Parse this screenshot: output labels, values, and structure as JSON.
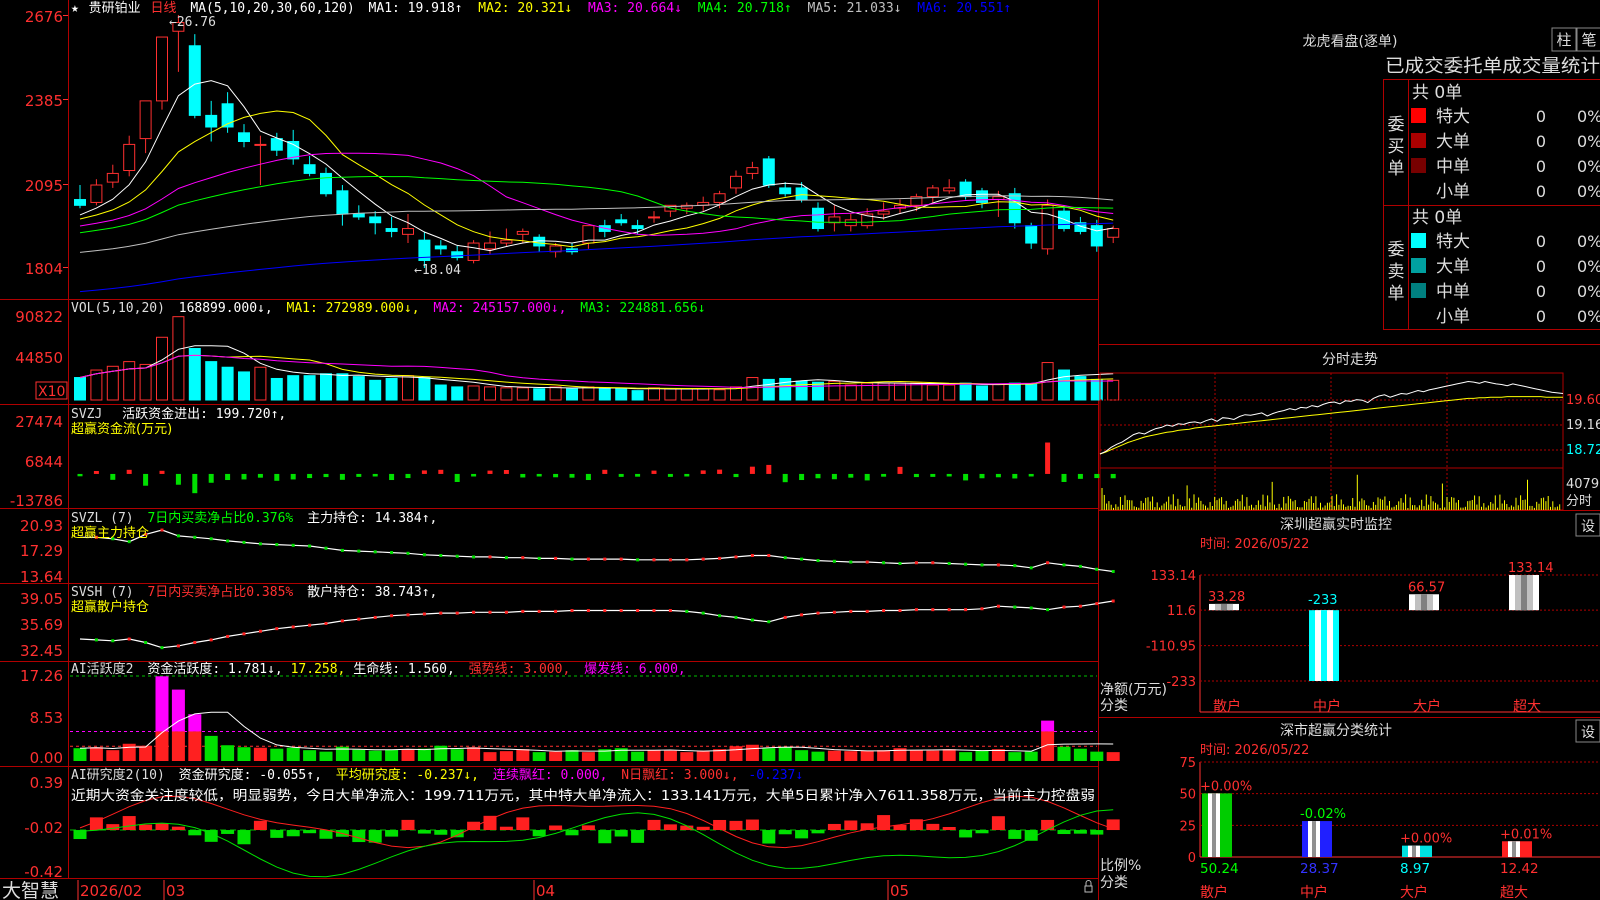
{
  "app": {
    "logo": "大智慧"
  },
  "kline": {
    "star": "★",
    "stock_name": "贵研铂业",
    "period": "日线",
    "ma_title": "MA(5,10,20,30,60,120)",
    "ma_items": [
      {
        "label": "MA1: 19.918↑",
        "color": "#ffffff"
      },
      {
        "label": "MA2: 20.321↓",
        "color": "#ffff00"
      },
      {
        "label": "MA3: 20.664↓",
        "color": "#ff00ff"
      },
      {
        "label": "MA4: 20.718↑",
        "color": "#00ff00"
      },
      {
        "label": "MA5: 21.033↓",
        "color": "#c0c0c0"
      },
      {
        "label": "MA6: 20.551↑",
        "color": "#0000ff"
      }
    ],
    "y_ticks": [
      "2676",
      "2385",
      "2095",
      "1804"
    ],
    "high_label": "←26.76",
    "low_label": "←18.04",
    "colors": {
      "up": "#ff3030",
      "down": "#00ffff",
      "ma1": "#ffffff",
      "ma2": "#ffff00",
      "ma3": "#ff00ff",
      "ma4": "#00ff00",
      "ma5": "#c0c0c0",
      "ma6": "#0000ff"
    },
    "candles": [
      {
        "o": 20.4,
        "h": 20.9,
        "l": 20.1,
        "c": 20.2
      },
      {
        "o": 20.3,
        "h": 21.1,
        "l": 20.2,
        "c": 20.9
      },
      {
        "o": 21.0,
        "h": 21.6,
        "l": 20.8,
        "c": 21.3
      },
      {
        "o": 21.4,
        "h": 22.6,
        "l": 21.2,
        "c": 22.3
      },
      {
        "o": 22.5,
        "h": 23.8,
        "l": 22.0,
        "c": 23.8
      },
      {
        "o": 23.8,
        "h": 26.0,
        "l": 23.5,
        "c": 26.0
      },
      {
        "o": 26.2,
        "h": 26.76,
        "l": 24.8,
        "c": 26.5
      },
      {
        "o": 25.7,
        "h": 26.1,
        "l": 23.2,
        "c": 23.3
      },
      {
        "o": 23.3,
        "h": 23.8,
        "l": 22.4,
        "c": 22.9
      },
      {
        "o": 23.7,
        "h": 24.1,
        "l": 22.7,
        "c": 22.9
      },
      {
        "o": 22.7,
        "h": 23.0,
        "l": 22.2,
        "c": 22.4
      },
      {
        "o": 22.3,
        "h": 22.6,
        "l": 20.9,
        "c": 22.3
      },
      {
        "o": 22.5,
        "h": 22.7,
        "l": 21.9,
        "c": 22.1
      },
      {
        "o": 22.4,
        "h": 22.8,
        "l": 21.6,
        "c": 21.8
      },
      {
        "o": 21.6,
        "h": 21.9,
        "l": 21.2,
        "c": 21.3
      },
      {
        "o": 21.3,
        "h": 21.5,
        "l": 20.5,
        "c": 20.6
      },
      {
        "o": 20.7,
        "h": 20.9,
        "l": 19.5,
        "c": 19.9
      },
      {
        "o": 19.9,
        "h": 20.2,
        "l": 19.7,
        "c": 19.8
      },
      {
        "o": 19.8,
        "h": 20.0,
        "l": 19.2,
        "c": 19.6
      },
      {
        "o": 19.4,
        "h": 19.8,
        "l": 19.1,
        "c": 19.3
      },
      {
        "o": 19.2,
        "h": 19.9,
        "l": 18.9,
        "c": 19.4
      },
      {
        "o": 19.0,
        "h": 19.3,
        "l": 18.04,
        "c": 18.3
      },
      {
        "o": 18.8,
        "h": 19.0,
        "l": 18.5,
        "c": 18.7
      },
      {
        "o": 18.6,
        "h": 18.8,
        "l": 18.3,
        "c": 18.4
      },
      {
        "o": 18.3,
        "h": 19.0,
        "l": 18.2,
        "c": 18.9
      },
      {
        "o": 18.7,
        "h": 19.3,
        "l": 18.5,
        "c": 18.9
      },
      {
        "o": 18.9,
        "h": 19.4,
        "l": 18.8,
        "c": 19.0
      },
      {
        "o": 19.2,
        "h": 19.4,
        "l": 18.9,
        "c": 19.3
      },
      {
        "o": 19.1,
        "h": 19.2,
        "l": 18.6,
        "c": 18.8
      },
      {
        "o": 18.6,
        "h": 18.9,
        "l": 18.4,
        "c": 18.8
      },
      {
        "o": 18.7,
        "h": 18.9,
        "l": 18.5,
        "c": 18.6
      },
      {
        "o": 18.9,
        "h": 19.5,
        "l": 18.7,
        "c": 19.5
      },
      {
        "o": 19.5,
        "h": 19.7,
        "l": 19.1,
        "c": 19.3
      },
      {
        "o": 19.7,
        "h": 19.9,
        "l": 19.5,
        "c": 19.6
      },
      {
        "o": 19.5,
        "h": 19.7,
        "l": 19.2,
        "c": 19.4
      },
      {
        "o": 19.8,
        "h": 20.0,
        "l": 19.6,
        "c": 19.8
      },
      {
        "o": 20.0,
        "h": 20.2,
        "l": 19.8,
        "c": 20.2
      },
      {
        "o": 20.1,
        "h": 20.3,
        "l": 19.9,
        "c": 20.2
      },
      {
        "o": 20.2,
        "h": 20.5,
        "l": 20.0,
        "c": 20.3
      },
      {
        "o": 20.3,
        "h": 20.7,
        "l": 20.1,
        "c": 20.6
      },
      {
        "o": 20.8,
        "h": 21.4,
        "l": 20.6,
        "c": 21.2
      },
      {
        "o": 21.3,
        "h": 21.7,
        "l": 21.1,
        "c": 21.5
      },
      {
        "o": 21.8,
        "h": 21.9,
        "l": 20.8,
        "c": 20.9
      },
      {
        "o": 20.8,
        "h": 21.0,
        "l": 20.5,
        "c": 20.6
      },
      {
        "o": 20.8,
        "h": 21.0,
        "l": 20.3,
        "c": 20.4
      },
      {
        "o": 20.1,
        "h": 20.3,
        "l": 19.3,
        "c": 19.4
      },
      {
        "o": 19.6,
        "h": 20.2,
        "l": 19.3,
        "c": 19.8
      },
      {
        "o": 19.5,
        "h": 19.9,
        "l": 19.3,
        "c": 19.7
      },
      {
        "o": 19.5,
        "h": 20.1,
        "l": 19.4,
        "c": 19.9
      },
      {
        "o": 19.9,
        "h": 20.3,
        "l": 19.7,
        "c": 20.0
      },
      {
        "o": 20.1,
        "h": 20.4,
        "l": 19.9,
        "c": 20.2
      },
      {
        "o": 20.2,
        "h": 20.6,
        "l": 20.0,
        "c": 20.5
      },
      {
        "o": 20.5,
        "h": 20.9,
        "l": 20.3,
        "c": 20.8
      },
      {
        "o": 20.7,
        "h": 21.1,
        "l": 20.6,
        "c": 20.8
      },
      {
        "o": 21.0,
        "h": 21.1,
        "l": 20.4,
        "c": 20.5
      },
      {
        "o": 20.7,
        "h": 20.8,
        "l": 20.1,
        "c": 20.3
      },
      {
        "o": 20.4,
        "h": 20.7,
        "l": 19.8,
        "c": 20.5
      },
      {
        "o": 20.6,
        "h": 20.8,
        "l": 19.4,
        "c": 19.6
      },
      {
        "o": 19.5,
        "h": 19.6,
        "l": 18.7,
        "c": 18.9
      },
      {
        "o": 18.7,
        "h": 20.4,
        "l": 18.5,
        "c": 20.2
      },
      {
        "o": 20.0,
        "h": 20.2,
        "l": 19.3,
        "c": 19.4
      },
      {
        "o": 19.6,
        "h": 19.8,
        "l": 19.2,
        "c": 19.3
      },
      {
        "o": 19.5,
        "h": 19.7,
        "l": 18.6,
        "c": 18.8
      },
      {
        "o": 19.1,
        "h": 19.5,
        "l": 18.9,
        "c": 19.4
      }
    ]
  },
  "volume": {
    "title": "VOL(5,10,20)",
    "v_label": "168899.000↓,",
    "ma_items": [
      {
        "label": "MA1: 272989.000↓,",
        "color": "#ffffff"
      },
      {
        "label": "MA2: 245157.000↓,",
        "color": "#ffff00"
      },
      {
        "label": "MA3: 224881.656↓",
        "color": "#ff00ff"
      }
    ],
    "y_ticks": [
      "90822",
      "44850"
    ],
    "unit": "X10",
    "values": [
      24,
      32,
      36,
      41,
      38,
      67,
      89,
      55,
      41,
      35,
      30,
      35,
      23,
      26,
      26,
      28,
      28,
      25,
      21,
      23,
      26,
      24,
      16,
      14,
      15,
      14,
      13,
      13,
      12,
      14,
      12,
      14,
      12,
      12,
      10,
      13,
      12,
      12,
      12,
      11,
      14,
      24,
      22,
      23,
      20,
      19,
      20,
      16,
      18,
      18,
      18,
      18,
      16,
      16,
      18,
      15,
      17,
      18,
      17,
      40,
      32,
      25,
      22,
      21
    ]
  },
  "svzj": {
    "title": "SVZJ",
    "label": "活跃资金进出: 199.720↑,",
    "subtitle": "超赢资金流(万元)",
    "y_ticks": [
      "27474",
      "6844",
      "-13786"
    ],
    "values": [
      -1200,
      1500,
      -3000,
      2100,
      -6000,
      1600,
      -5500,
      -9800,
      -4500,
      -3100,
      -2800,
      -1900,
      -3500,
      -2800,
      -2100,
      -1600,
      -3000,
      -1500,
      -1300,
      -3100,
      -2100,
      1800,
      2100,
      -4100,
      -1300,
      1700,
      2000,
      -1800,
      -1300,
      -1700,
      -1900,
      -3100,
      2100,
      -1500,
      -1400,
      1700,
      -1500,
      -1300,
      1800,
      2200,
      -1600,
      3700,
      4600,
      -4200,
      -3100,
      -2200,
      -2700,
      -1900,
      -3300,
      -1400,
      3600,
      -1600,
      -1500,
      -1300,
      -3300,
      -2200,
      -1700,
      -2300,
      -1300,
      16000,
      -4100,
      -2500,
      -2100,
      -2200
    ]
  },
  "svzl": {
    "title": "SVZL (7)",
    "label1": "7日内买卖净占比0.376%",
    "label2": "主力持仓: 14.384↑,",
    "subtitle": "超赢主力持仓",
    "y_ticks": [
      "20.93",
      "17.29",
      "13.64"
    ],
    "values": [
      19.1,
      19.1,
      18.9,
      18.5,
      19.5,
      20.1,
      19.3,
      19.1,
      18.9,
      18.6,
      18.4,
      18.2,
      18.1,
      18.0,
      17.9,
      17.6,
      17.3,
      17.2,
      17.1,
      17.0,
      16.9,
      16.7,
      16.6,
      16.5,
      16.4,
      16.4,
      16.3,
      16.3,
      16.2,
      16.2,
      16.1,
      16.1,
      16.1,
      16.1,
      16.0,
      16.0,
      16.0,
      16.0,
      16.1,
      16.2,
      16.4,
      16.6,
      16.6,
      16.3,
      16.1,
      15.9,
      15.8,
      15.7,
      15.7,
      15.6,
      15.5,
      15.6,
      15.6,
      15.5,
      15.4,
      15.3,
      15.3,
      15.2,
      14.9,
      15.6,
      15.3,
      15.1,
      14.7,
      14.4
    ]
  },
  "svsh": {
    "title": "SVSH (7)",
    "label1": "7日内买卖净占比0.385%",
    "label2": "散户持仓: 38.743↑,",
    "subtitle": "超赢散户持仓",
    "y_ticks": [
      "39.05",
      "35.69",
      "32.45"
    ],
    "values": [
      34.3,
      34.2,
      34.1,
      34.3,
      33.9,
      33.3,
      33.5,
      33.9,
      34.2,
      34.6,
      34.9,
      35.2,
      35.5,
      35.7,
      35.9,
      36.1,
      36.4,
      36.6,
      36.8,
      37.0,
      37.1,
      37.2,
      37.3,
      37.3,
      37.4,
      37.4,
      37.4,
      37.5,
      37.5,
      37.5,
      37.6,
      37.6,
      37.6,
      37.6,
      37.6,
      37.6,
      37.6,
      37.5,
      37.3,
      37.0,
      36.8,
      36.5,
      36.3,
      36.8,
      37.1,
      37.3,
      37.4,
      37.5,
      37.5,
      37.6,
      37.6,
      37.7,
      37.7,
      37.7,
      37.7,
      37.8,
      38.1,
      38.0,
      37.9,
      37.7,
      38.0,
      38.1,
      38.4,
      38.7
    ]
  },
  "ai_active": {
    "title": "AI活跃度2",
    "label1": "资金活跃度: 1.781↓,",
    "label2": "17.258,",
    "label3": "生命线: 1.560,",
    "label4": "强势线: 3.000,",
    "label5": "爆发线: 6.000,",
    "y_ticks": [
      "17.26",
      "8.53",
      "0.00"
    ],
    "values": [
      2.6,
      2.8,
      2.2,
      3.5,
      3.1,
      17.2,
      14.5,
      9.5,
      5.1,
      3.2,
      2.8,
      2.7,
      2.5,
      2.7,
      2.2,
      1.9,
      2.9,
      2.3,
      2.1,
      2.3,
      2.4,
      2.5,
      3.1,
      2.4,
      2.8,
      1.8,
      2.0,
      2.4,
      1.8,
      1.9,
      2.2,
      1.8,
      2.4,
      2.6,
      1.9,
      2.2,
      2.1,
      1.8,
      2.1,
      2.4,
      3.0,
      3.3,
      2.6,
      2.8,
      2.2,
      1.9,
      2.1,
      2.0,
      2.1,
      2.2,
      2.6,
      2.2,
      2.1,
      2.4,
      1.8,
      2.1,
      2.4,
      1.8,
      1.9,
      8.2,
      2.9,
      2.5,
      1.9,
      1.8
    ]
  },
  "ai_research": {
    "title": "AI研究度2(10)",
    "label1": "资金研究度: -0.055↑,",
    "label2": "平均研究度: -0.237↓,",
    "label3": "连续飘红: 0.000,",
    "label4": "N日飘红: 3.000↓,",
    "label5": "-0.237↓",
    "comment": "近期大资金关注度较低，明显弱势，今日大单净流入：199.711万元，其中特大单净流入：133.141万元，大单5日累计净入7611.358万元，当前主力控盘弱",
    "y_ticks": [
      "0.39",
      "-0.02",
      "-0.42"
    ]
  },
  "date_axis": {
    "labels": [
      "2026/02",
      "03",
      "04",
      "05"
    ]
  },
  "right": {
    "dragon_title": "龙虎看盘(逐单)",
    "btn_bar": "柱",
    "btn_bi": "笔",
    "header": "已成交委托单成交量统计",
    "buy": {
      "side": "委买单",
      "total": "共 0单",
      "rows": [
        {
          "label": "特大",
          "count": "0",
          "pct": "0%",
          "color": "#ff0000"
        },
        {
          "label": "大单",
          "count": "0",
          "pct": "0%",
          "color": "#aa0000"
        },
        {
          "label": "中单",
          "count": "0",
          "pct": "0%",
          "color": "#770000"
        },
        {
          "label": "小单",
          "count": "0",
          "pct": "0%",
          "color": ""
        }
      ]
    },
    "sell": {
      "side": "委卖单",
      "total": "共 0单",
      "rows": [
        {
          "label": "特大",
          "count": "0",
          "pct": "0%",
          "color": "#00ffff"
        },
        {
          "label": "大单",
          "count": "0",
          "pct": "0%",
          "color": "#00a0a0"
        },
        {
          "label": "中单",
          "count": "0",
          "pct": "0%",
          "color": "#008080"
        },
        {
          "label": "小单",
          "count": "0",
          "pct": "0%",
          "color": ""
        }
      ]
    },
    "intraday": {
      "title": "分时走势",
      "y_ticks": [
        "19.60",
        "19.16",
        "18.72"
      ],
      "vol_tick": "4079",
      "vol_label": "分时",
      "price": [
        18.7,
        18.74,
        18.81,
        18.86,
        18.9,
        18.96,
        19.02,
        19.05,
        19.03,
        19.08,
        19.12,
        19.14,
        19.18,
        19.16,
        19.2,
        19.19,
        19.22,
        19.23,
        19.21,
        19.25,
        19.28,
        19.24,
        19.3,
        19.29,
        19.27,
        19.32,
        19.35,
        19.34,
        19.36,
        19.38,
        19.33,
        19.37,
        19.4,
        19.42,
        19.45,
        19.43,
        19.47,
        19.46,
        19.5,
        19.48,
        19.52,
        19.55,
        19.56,
        19.53,
        19.58,
        19.57,
        19.6,
        19.59,
        19.55,
        19.62,
        19.66,
        19.68,
        19.64,
        19.67,
        19.7,
        19.69,
        19.72,
        19.75,
        19.73,
        19.76,
        19.78,
        19.8,
        19.82,
        19.84,
        19.86,
        19.88,
        19.9,
        19.89,
        19.87,
        19.9,
        19.88,
        19.86,
        19.85,
        19.83,
        19.86,
        19.84,
        19.82,
        19.8,
        19.78,
        19.76,
        19.74,
        19.72,
        19.71,
        19.7
      ],
      "avg": [
        18.7,
        18.73,
        18.77,
        18.81,
        18.85,
        18.89,
        18.92,
        18.95,
        18.98,
        19.0,
        19.02,
        19.04,
        19.06,
        19.07,
        19.09,
        19.1,
        19.11,
        19.13,
        19.14,
        19.15,
        19.16,
        19.17,
        19.18,
        19.19,
        19.2,
        19.21,
        19.22,
        19.23,
        19.24,
        19.25,
        19.26,
        19.27,
        19.28,
        19.29,
        19.3,
        19.31,
        19.32,
        19.33,
        19.34,
        19.35,
        19.36,
        19.37,
        19.38,
        19.39,
        19.4,
        19.41,
        19.42,
        19.43,
        19.44,
        19.45,
        19.46,
        19.47,
        19.48,
        19.49,
        19.5,
        19.51,
        19.52,
        19.53,
        19.54,
        19.55,
        19.56,
        19.57,
        19.58,
        19.59,
        19.6,
        19.61,
        19.62,
        19.62,
        19.63,
        19.63,
        19.64,
        19.64,
        19.64,
        19.65,
        19.65,
        19.65,
        19.65,
        19.65,
        19.65,
        19.65,
        19.64,
        19.64,
        19.64,
        19.64
      ]
    },
    "monitor": {
      "title": "深圳超赢实时监控",
      "btn": "设",
      "time": "时间: 2026/05/22",
      "y_ticks": [
        "133.14",
        "11.6",
        "-110.95",
        "-233"
      ],
      "y_label": "净额(万元)",
      "x_label": "分类",
      "bars": [
        {
          "cat": "散户",
          "value": 33.28,
          "label": "33.28",
          "label_color": "#ff3030"
        },
        {
          "cat": "中户",
          "value": -233,
          "label": "-233",
          "label_color": "#00ffff"
        },
        {
          "cat": "大户",
          "value": 66.57,
          "label": "66.57",
          "label_color": "#ff3030"
        },
        {
          "cat": "超大",
          "value": 133.14,
          "label": "133.14",
          "label_color": "#ff3030"
        }
      ]
    },
    "classify": {
      "title": "深市超赢分类统计",
      "btn": "设",
      "time": "时间: 2026/05/22",
      "y_ticks": [
        "75",
        "50",
        "25",
        "0"
      ],
      "y_label": "比例%",
      "x_label": "分类",
      "bars": [
        {
          "cat": "散户",
          "value": 50.24,
          "label": "50.24",
          "change": "+0.00%",
          "change_color": "#ff3030",
          "value_color": "#00ff00",
          "fill": "#00cc00"
        },
        {
          "cat": "中户",
          "value": 28.37,
          "label": "28.37",
          "change": "-0.02%",
          "change_color": "#00ff00",
          "value_color": "#3333ff",
          "fill": "#2020ff"
        },
        {
          "cat": "大户",
          "value": 8.97,
          "label": "8.97",
          "change": "+0.00%",
          "change_color": "#ff3030",
          "value_color": "#00ffff",
          "fill": "#00e0e0"
        },
        {
          "cat": "超大",
          "value": 12.42,
          "label": "12.42",
          "change": "+0.01%",
          "change_color": "#ff3030",
          "value_color": "#ff3030",
          "fill": "#ff2020"
        }
      ]
    }
  }
}
